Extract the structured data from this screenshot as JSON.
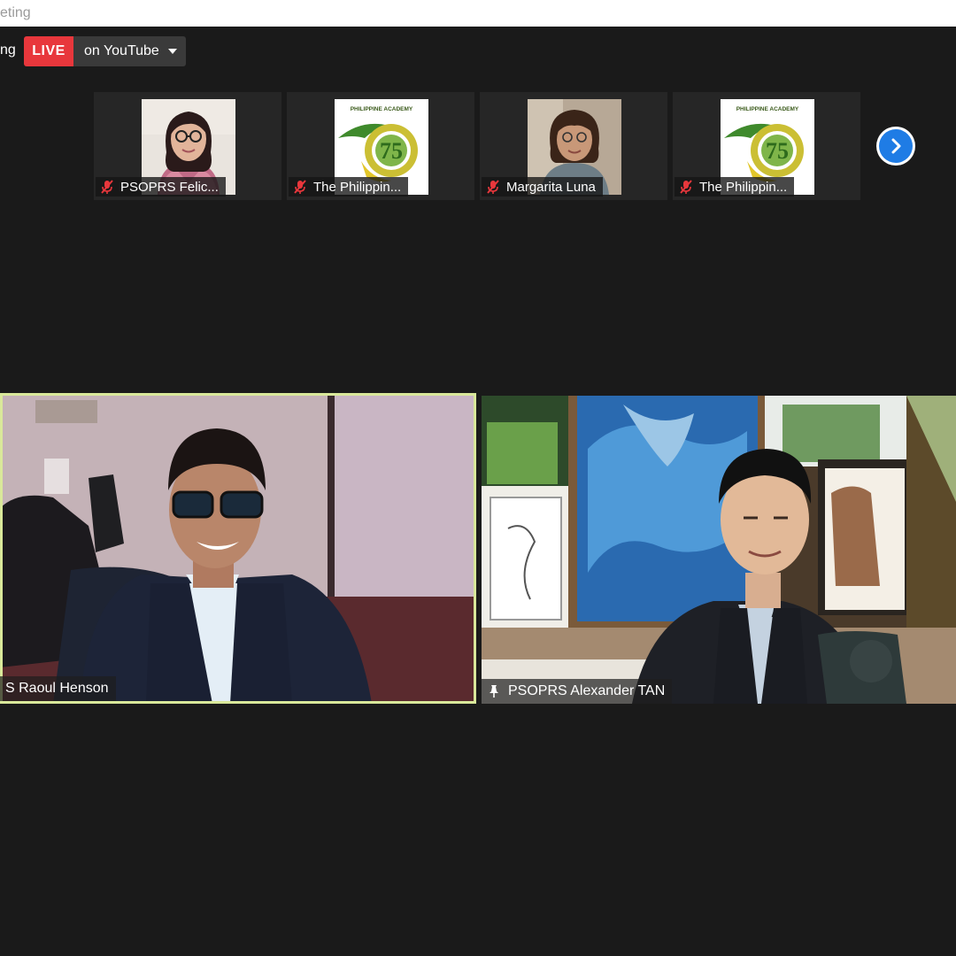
{
  "window": {
    "title_fragment": "eting"
  },
  "streaming": {
    "status_fragment": "ng",
    "live_label": "LIVE",
    "platform_label": "on YouTube"
  },
  "thumbnails": [
    {
      "name": "PSOPRS Felic...",
      "muted": true,
      "image": "woman-with-glasses-photo"
    },
    {
      "name": "The Philippin...",
      "muted": true,
      "image": "philippine-academy-75-logo"
    },
    {
      "name": "Margarita Luna",
      "muted": true,
      "image": "woman-portrait-photo"
    },
    {
      "name": "The Philippin...",
      "muted": true,
      "image": "philippine-academy-75-logo"
    }
  ],
  "logo_text": {
    "top": "PHILIPPINE ACADEMY",
    "number": "75"
  },
  "next_page_icon": "chevron-right-icon",
  "videos": {
    "left": {
      "name": "S Raoul Henson",
      "active_speaker": true
    },
    "right": {
      "name": "PSOPRS Alexander TAN",
      "pinned": true
    }
  },
  "colors": {
    "live_red": "#e8373c",
    "active_speaker_border": "#d9e89a",
    "next_button_blue": "#1f7ce5",
    "background": "#1a1a1a",
    "muted_icon": "#e8373c"
  }
}
